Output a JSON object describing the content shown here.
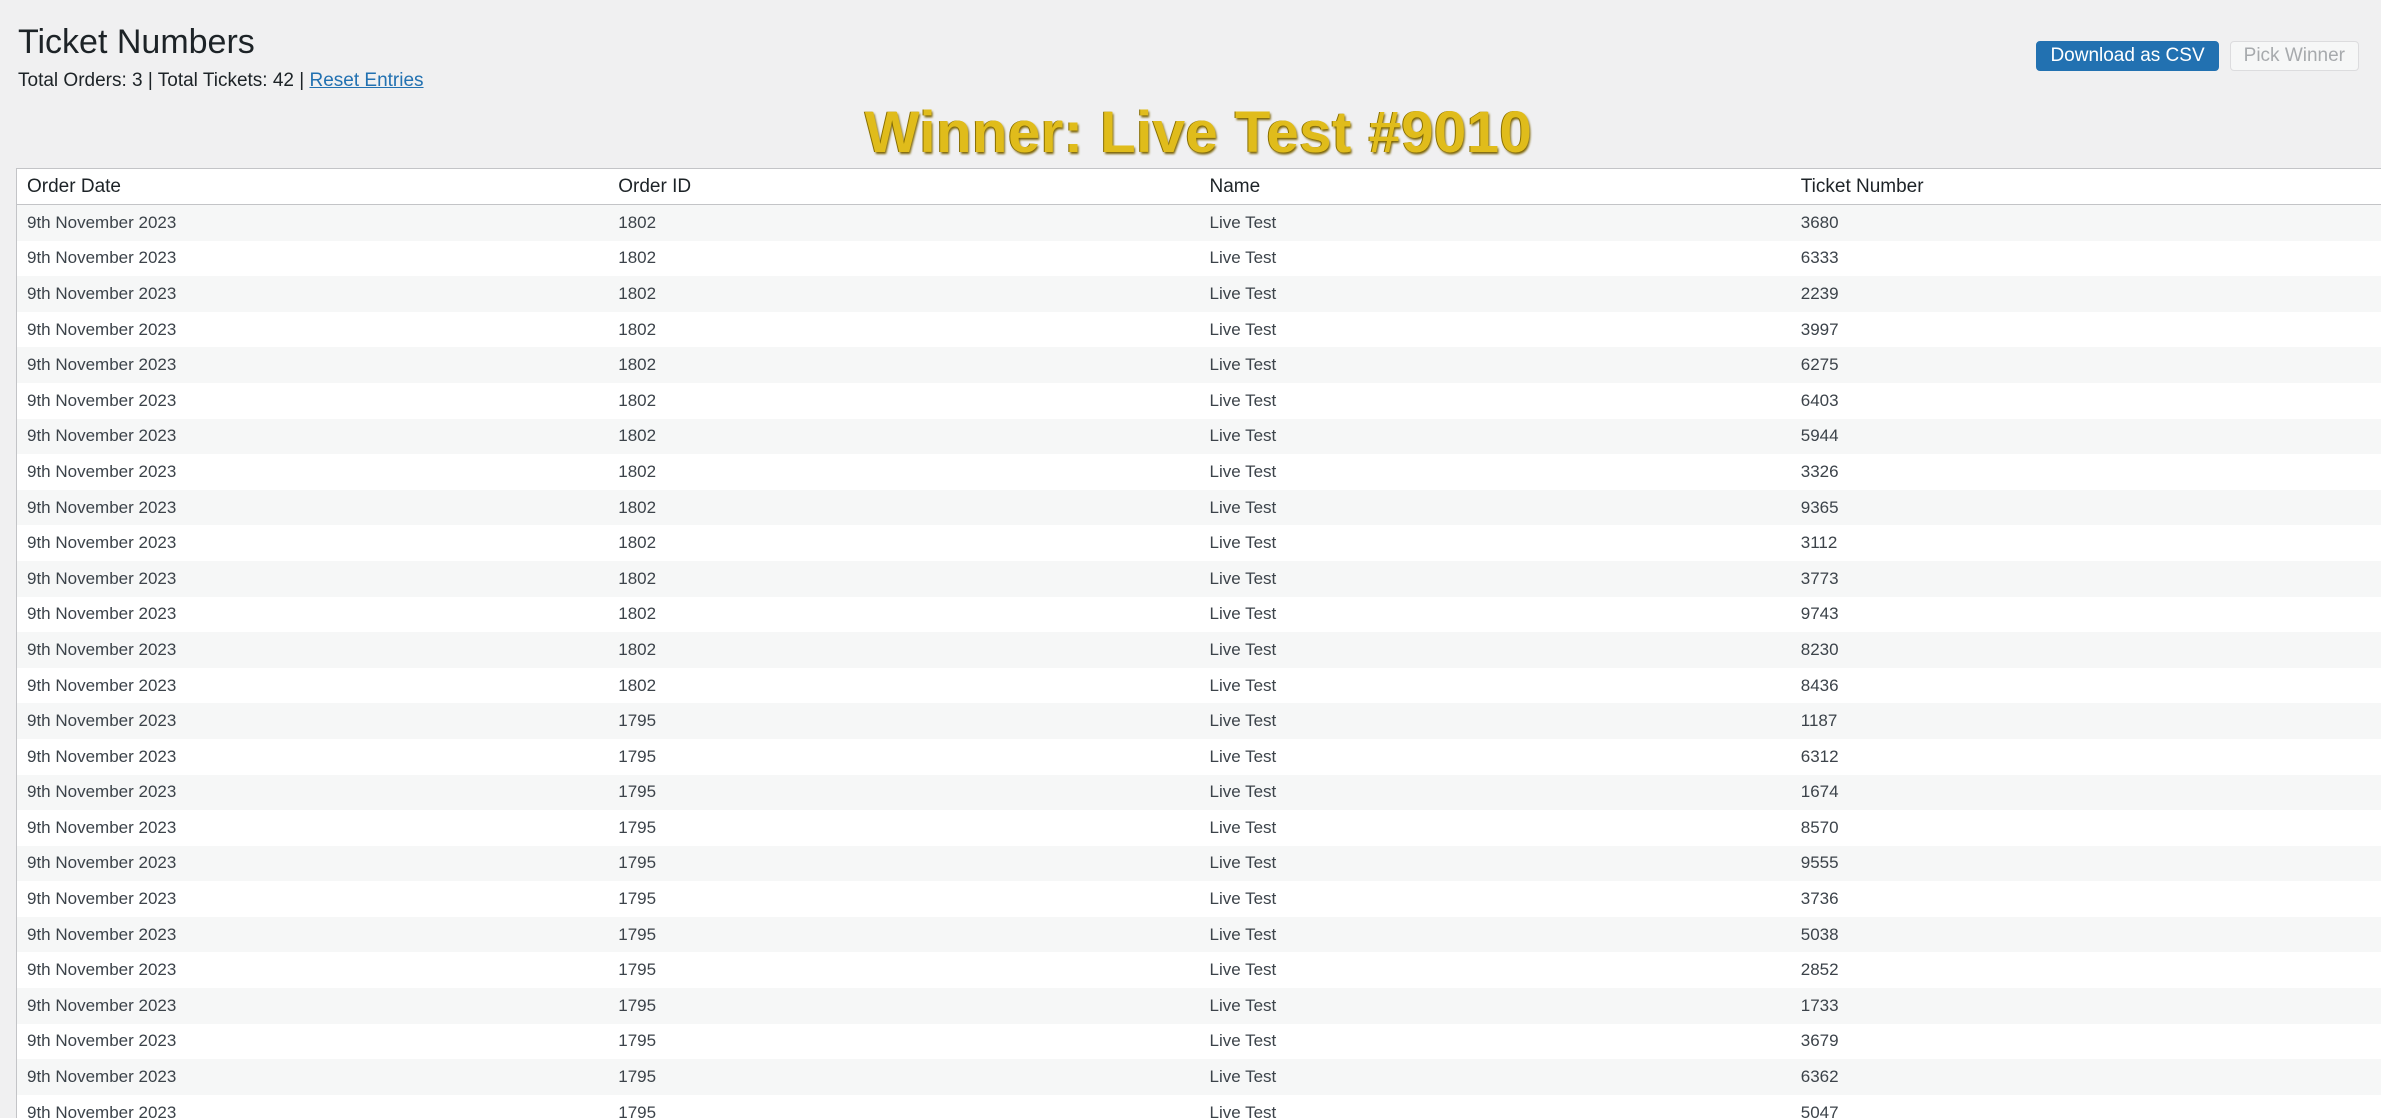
{
  "header": {
    "title": "Ticket Numbers",
    "stats_prefix": "Total Orders: 3 | Total Tickets: 42 |",
    "reset_label": "Reset Entries"
  },
  "actions": {
    "download_label": "Download as CSV",
    "pick_label": "Pick Winner"
  },
  "winner": {
    "text": "Winner: Live Test #9010",
    "color": "#e0bc1b"
  },
  "table": {
    "columns": [
      "Order Date",
      "Order ID",
      "Name",
      "Ticket Number"
    ],
    "rows": [
      [
        "9th November 2023",
        "1802",
        "Live Test",
        "3680"
      ],
      [
        "9th November 2023",
        "1802",
        "Live Test",
        "6333"
      ],
      [
        "9th November 2023",
        "1802",
        "Live Test",
        "2239"
      ],
      [
        "9th November 2023",
        "1802",
        "Live Test",
        "3997"
      ],
      [
        "9th November 2023",
        "1802",
        "Live Test",
        "6275"
      ],
      [
        "9th November 2023",
        "1802",
        "Live Test",
        "6403"
      ],
      [
        "9th November 2023",
        "1802",
        "Live Test",
        "5944"
      ],
      [
        "9th November 2023",
        "1802",
        "Live Test",
        "3326"
      ],
      [
        "9th November 2023",
        "1802",
        "Live Test",
        "9365"
      ],
      [
        "9th November 2023",
        "1802",
        "Live Test",
        "3112"
      ],
      [
        "9th November 2023",
        "1802",
        "Live Test",
        "3773"
      ],
      [
        "9th November 2023",
        "1802",
        "Live Test",
        "9743"
      ],
      [
        "9th November 2023",
        "1802",
        "Live Test",
        "8230"
      ],
      [
        "9th November 2023",
        "1802",
        "Live Test",
        "8436"
      ],
      [
        "9th November 2023",
        "1795",
        "Live Test",
        "1187"
      ],
      [
        "9th November 2023",
        "1795",
        "Live Test",
        "6312"
      ],
      [
        "9th November 2023",
        "1795",
        "Live Test",
        "1674"
      ],
      [
        "9th November 2023",
        "1795",
        "Live Test",
        "8570"
      ],
      [
        "9th November 2023",
        "1795",
        "Live Test",
        "9555"
      ],
      [
        "9th November 2023",
        "1795",
        "Live Test",
        "3736"
      ],
      [
        "9th November 2023",
        "1795",
        "Live Test",
        "5038"
      ],
      [
        "9th November 2023",
        "1795",
        "Live Test",
        "2852"
      ],
      [
        "9th November 2023",
        "1795",
        "Live Test",
        "1733"
      ],
      [
        "9th November 2023",
        "1795",
        "Live Test",
        "3679"
      ],
      [
        "9th November 2023",
        "1795",
        "Live Test",
        "6362"
      ],
      [
        "9th November 2023",
        "1795",
        "Live Test",
        "5047"
      ]
    ]
  }
}
